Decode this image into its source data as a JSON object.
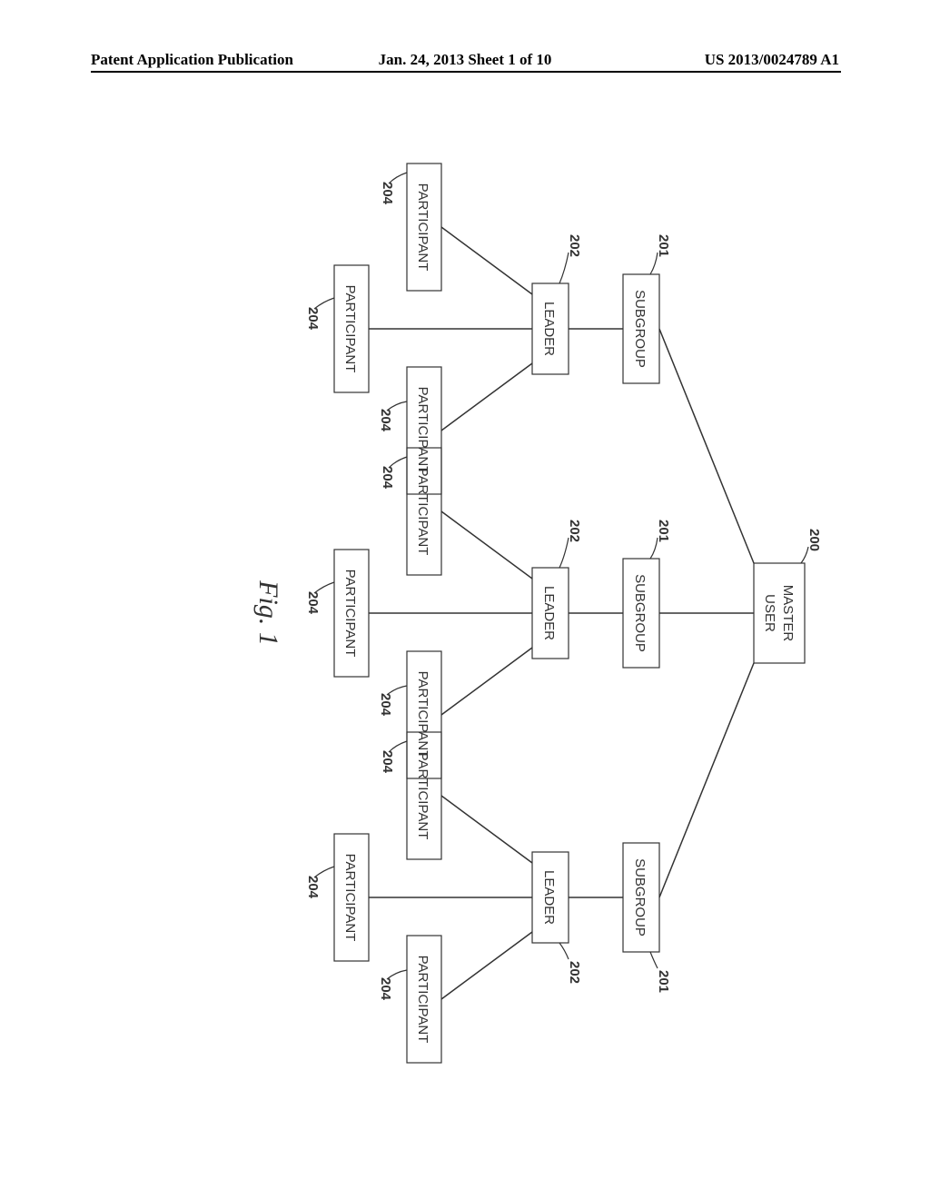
{
  "header": {
    "left": "Patent Application Publication",
    "center": "Jan. 24, 2013  Sheet 1 of 10",
    "right": "US 2013/0024789 A1"
  },
  "refs": {
    "master": "200",
    "subgroup": "201",
    "leader": "202",
    "participant": "204"
  },
  "labels": {
    "master_line1": "MASTER",
    "master_line2": "USER",
    "subgroup": "SUBGROUP",
    "leader": "LEADER",
    "participant": "PARTICIPANT"
  },
  "figure_caption": "Fig. 1"
}
